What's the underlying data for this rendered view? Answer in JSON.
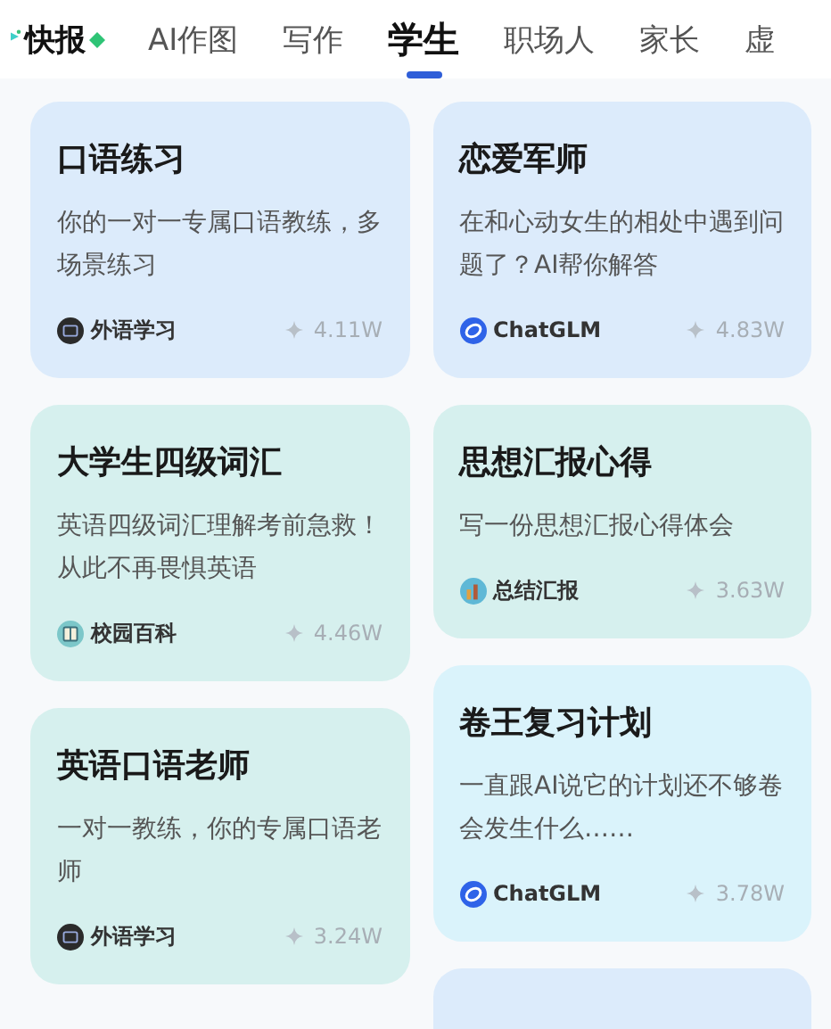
{
  "tabs": [
    {
      "label": "快报",
      "kind": "news",
      "selected": false
    },
    {
      "label": "AI作图",
      "kind": "plain",
      "selected": false
    },
    {
      "label": "写作",
      "kind": "plain",
      "selected": false
    },
    {
      "label": "学生",
      "kind": "plain",
      "selected": true
    },
    {
      "label": "职场人",
      "kind": "plain",
      "selected": false
    },
    {
      "label": "家长",
      "kind": "plain",
      "selected": false
    },
    {
      "label": "虚",
      "kind": "plain",
      "selected": false
    }
  ],
  "columns": [
    {
      "cards": [
        {
          "title": "口语练习",
          "description": "你的一对一专属口语教练，多场景练习",
          "source": "外语学习",
          "kind": "dark",
          "count": "4.11W",
          "color": "#dcebfb"
        },
        {
          "title": "大学生四级词汇",
          "description": "英语四级词汇理解考前急救！从此不再畏惧英语",
          "source": "校园百科",
          "kind": "book",
          "count": "4.46W",
          "color": "#d6f0ee"
        },
        {
          "title": "英语口语老师",
          "description": "一对一教练，你的专属口语老师",
          "source": "外语学习",
          "kind": "dark",
          "count": "3.24W",
          "color": "#d6f0ee"
        }
      ]
    },
    {
      "cards": [
        {
          "title": "恋爱军师",
          "description": "在和心动女生的相处中遇到问题了？AI帮你解答",
          "source": "ChatGLM",
          "kind": "chatglm",
          "count": "4.83W",
          "color": "#dcebfb"
        },
        {
          "title": "思想汇报心得",
          "description": "写一份思想汇报心得体会",
          "source": "总结汇报",
          "kind": "report",
          "count": "3.63W",
          "color": "#d6f0ee"
        },
        {
          "title": "卷王复习计划",
          "description": "一直跟AI说它的计划还不够卷会发生什么……",
          "source": "ChatGLM",
          "kind": "chatglm",
          "count": "3.78W",
          "color": "#daf3fb"
        },
        {
          "color": "#dcebfb"
        }
      ]
    }
  ]
}
